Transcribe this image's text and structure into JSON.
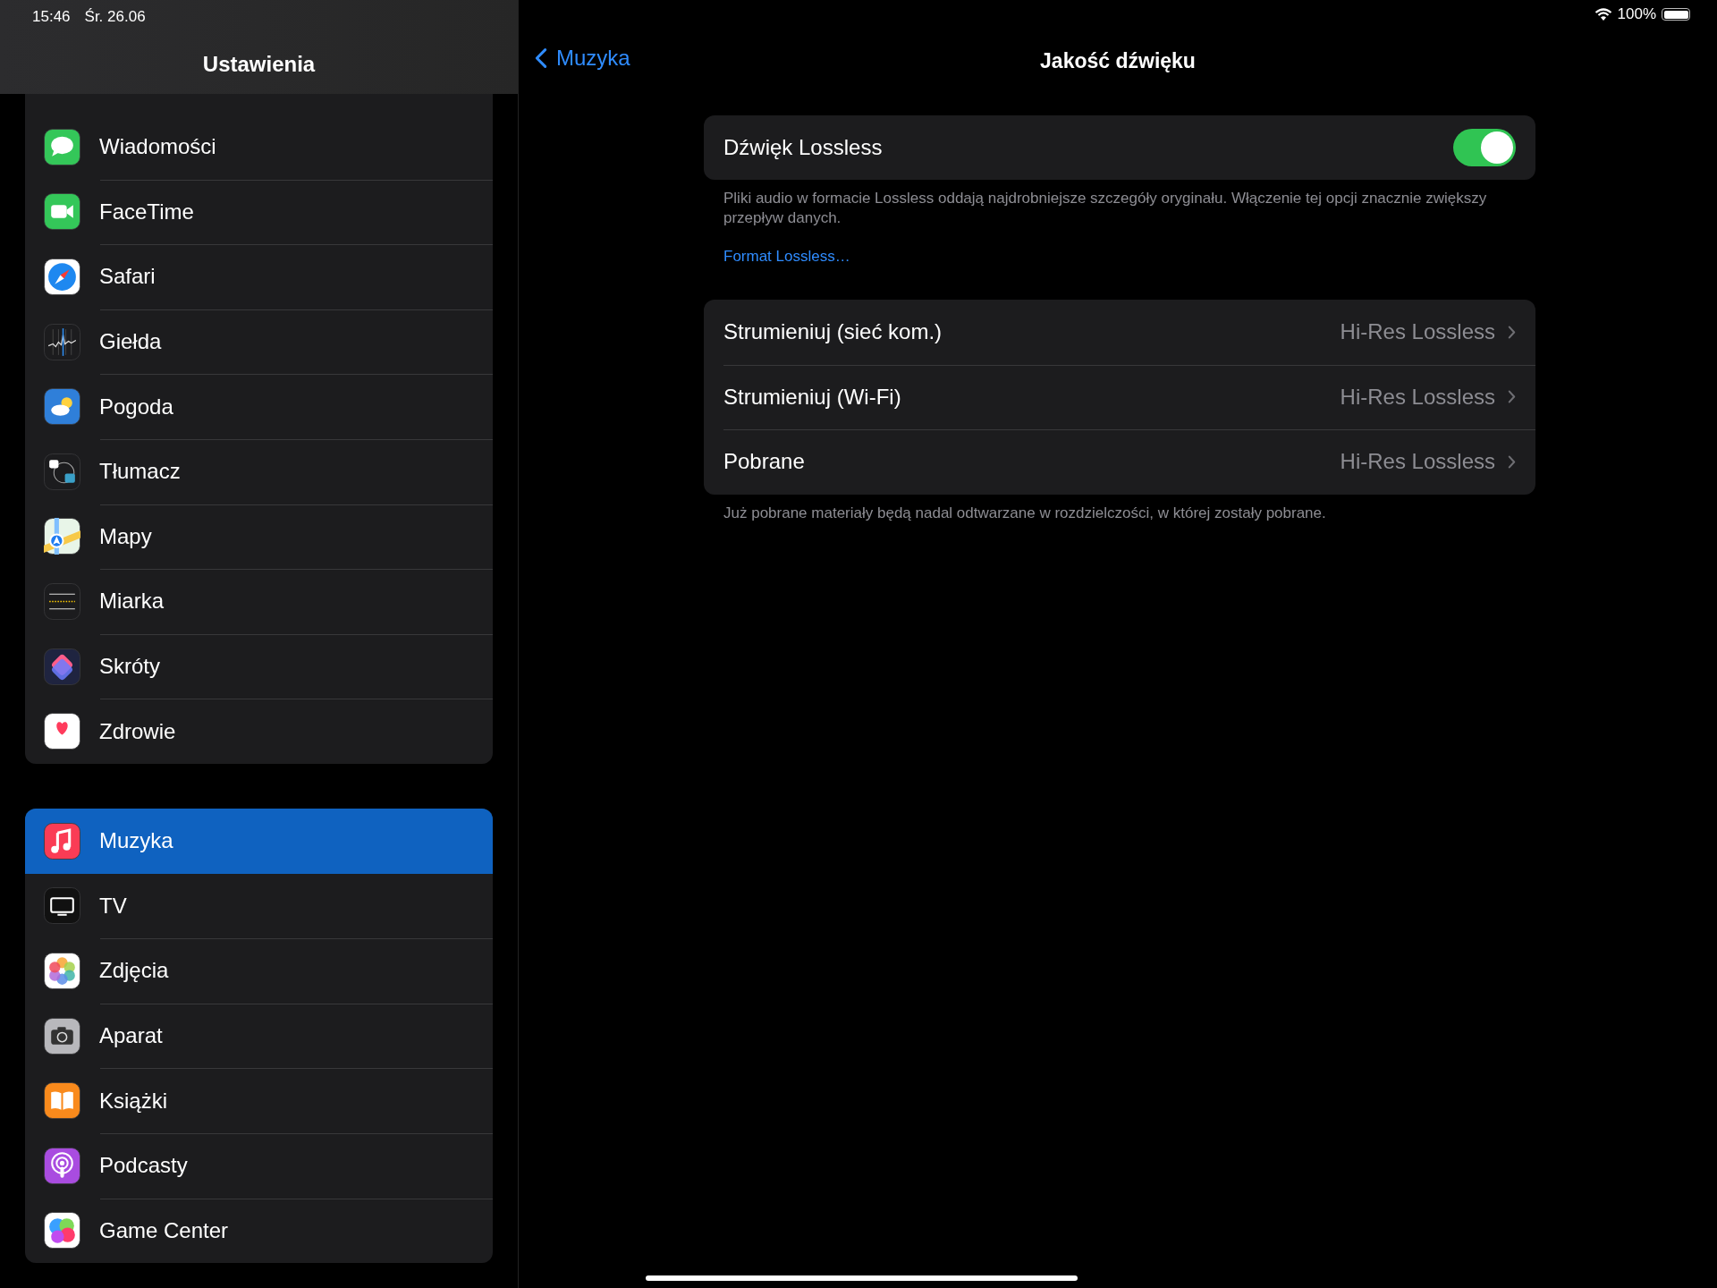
{
  "status_bar": {
    "time": "15:46",
    "date": "Śr. 26.06",
    "battery": "100%"
  },
  "sidebar": {
    "title": "Ustawienia",
    "groups": [
      {
        "items": [
          {
            "label": "Wiadomości",
            "selected": false
          },
          {
            "label": "FaceTime",
            "selected": false
          },
          {
            "label": "Safari",
            "selected": false
          },
          {
            "label": "Giełda",
            "selected": false
          },
          {
            "label": "Pogoda",
            "selected": false
          },
          {
            "label": "Tłumacz",
            "selected": false
          },
          {
            "label": "Mapy",
            "selected": false
          },
          {
            "label": "Miarka",
            "selected": false
          },
          {
            "label": "Skróty",
            "selected": false
          },
          {
            "label": "Zdrowie",
            "selected": false
          }
        ]
      },
      {
        "items": [
          {
            "label": "Muzyka",
            "selected": true
          },
          {
            "label": "TV",
            "selected": false
          },
          {
            "label": "Zdjęcia",
            "selected": false
          },
          {
            "label": "Aparat",
            "selected": false
          },
          {
            "label": "Książki",
            "selected": false
          },
          {
            "label": "Podcasty",
            "selected": false
          },
          {
            "label": "Game Center",
            "selected": false
          }
        ]
      }
    ]
  },
  "detail": {
    "back": "Muzyka",
    "title": "Jakość dźwięku",
    "toggle": {
      "label": "Dźwięk Lossless",
      "on": true
    },
    "toggle_footer": "Pliki audio w formacie Lossless oddają najdrobniejsze szczegóły oryginału. Włączenie tej opcji znacznie zwiększy przepływ danych.",
    "link": "Format Lossless…",
    "rows": [
      {
        "label": "Strumieniuj (sieć kom.)",
        "value": "Hi-Res Lossless"
      },
      {
        "label": "Strumieniuj (Wi-Fi)",
        "value": "Hi-Res Lossless"
      },
      {
        "label": "Pobrane",
        "value": "Hi-Res Lossless"
      }
    ],
    "rows_footer": "Już pobrane materiały będą nadal odtwarzane w rozdzielczości, w której zostały pobrane."
  }
}
